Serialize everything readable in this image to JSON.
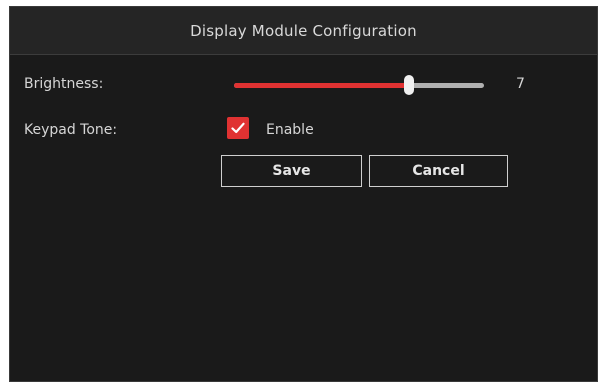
{
  "window": {
    "title": "Display Module Configuration"
  },
  "brightness": {
    "label": "Brightness:",
    "value": "7",
    "min": 0,
    "max": 10,
    "level": 7
  },
  "keypad_tone": {
    "label": "Keypad Tone:",
    "checkbox_label": "Enable",
    "checked": true
  },
  "buttons": {
    "save_label": "Save",
    "cancel_label": "Cancel"
  },
  "colors": {
    "background": "#1a1a1a",
    "accent": "#e03232",
    "track": "#b0b0b0",
    "text": "#d6d6d6"
  },
  "icons": {
    "checkbox": "checkmark-icon"
  }
}
